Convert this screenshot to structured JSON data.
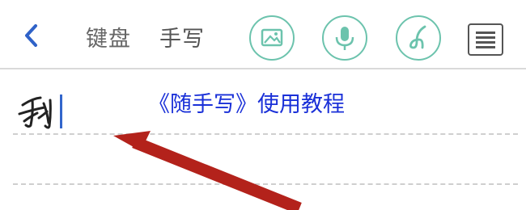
{
  "toolbar": {
    "back_icon": "chevron-left-icon",
    "tabs": [
      {
        "label": "键盘"
      },
      {
        "label": "手写"
      }
    ],
    "buttons": [
      {
        "icon": "image-icon"
      },
      {
        "icon": "microphone-icon"
      },
      {
        "icon": "pen-icon"
      },
      {
        "icon": "menu-icon"
      }
    ],
    "accent_color": "#6cc3ad"
  },
  "editor": {
    "caption": "《随手写》使用教程",
    "caption_color": "#1a30d8",
    "handwritten_text": "我"
  },
  "annotation": {
    "arrow_color": "#b3221b"
  }
}
